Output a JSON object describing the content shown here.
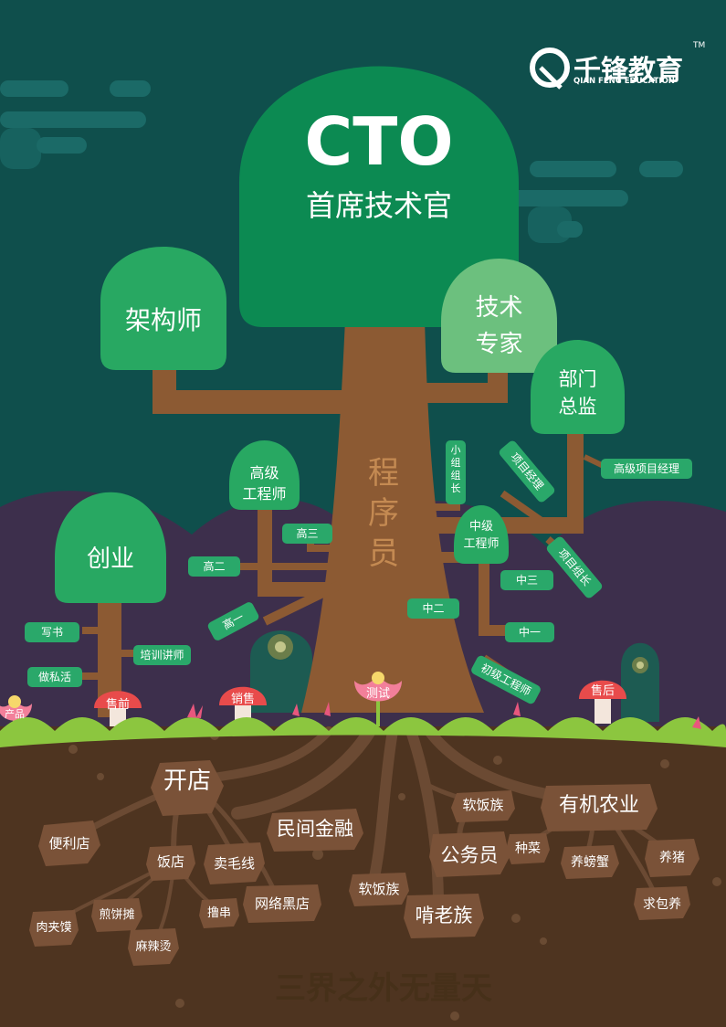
{
  "brand": {
    "name": "千锋教育",
    "tagline": "QIAN FENG EDUCATION",
    "tm": "TM"
  },
  "crown": {
    "title": "CTO",
    "subtitle": "首席技术官"
  },
  "trunk_label": [
    "程",
    "序",
    "员"
  ],
  "branches": {
    "architect": "架构师",
    "tech_expert_line1": "技术",
    "tech_expert_line2": "专家",
    "dept_head_line1": "部门",
    "dept_head_line2": "总监",
    "senior_line1": "高级",
    "senior_line2": "工程师",
    "mid_line1": "中级",
    "mid_line2": "工程师",
    "startup": "创业"
  },
  "pills": {
    "senior_pm": "高级项目经理",
    "team_lead": [
      "小",
      "组",
      "组",
      "长"
    ],
    "project_manager": "项目经理",
    "project_lead": "项目组长",
    "gao_san": "高三",
    "gao_er": "高二",
    "gao_yi": "高一",
    "zhong_san": "中三",
    "zhong_er": "中二",
    "zhong_yi": "中一",
    "junior": "初级工程师",
    "write_book": "写书",
    "trainer": "培训讲师",
    "side_job": "做私活"
  },
  "mushrooms": {
    "product": "产品",
    "presale": "售前",
    "sales": "销售",
    "testing": "测试",
    "aftersale": "售后"
  },
  "roots": {
    "open_shop": "开店",
    "private_finance": "民间金融",
    "soft_rice_1": "软饭族",
    "organic_farming": "有机农业",
    "convenience_store": "便利店",
    "restaurant": "饭店",
    "sell_yarn": "卖毛线",
    "online_black_shop": "网络黑店",
    "soft_rice_2": "软饭族",
    "civil_servant": "公务员",
    "grow_vegetables": "种菜",
    "raise_crabs": "养螃蟹",
    "raise_pigs": "养猪",
    "roujiamo": "肉夹馍",
    "jianbing": "煎饼摊",
    "skewers": "撸串",
    "malatang": "麻辣烫",
    "neet": "啃老族",
    "begging": "求包养"
  },
  "footer": "三界之外无量天",
  "colors": {
    "sky": "#0f4f4c",
    "hills": "#3d2f4c",
    "trunk": "#8c5a33",
    "crown_dark": "#0c8a52",
    "crown_mid": "#28a862",
    "crown_light": "#6cc07e",
    "pill": "#2aa86a",
    "grass": "#8cc63f",
    "soil": "#4e3420",
    "root": "#6b4a33",
    "mushroom_red": "#e84b4b",
    "flower_pink": "#f27f9a"
  }
}
